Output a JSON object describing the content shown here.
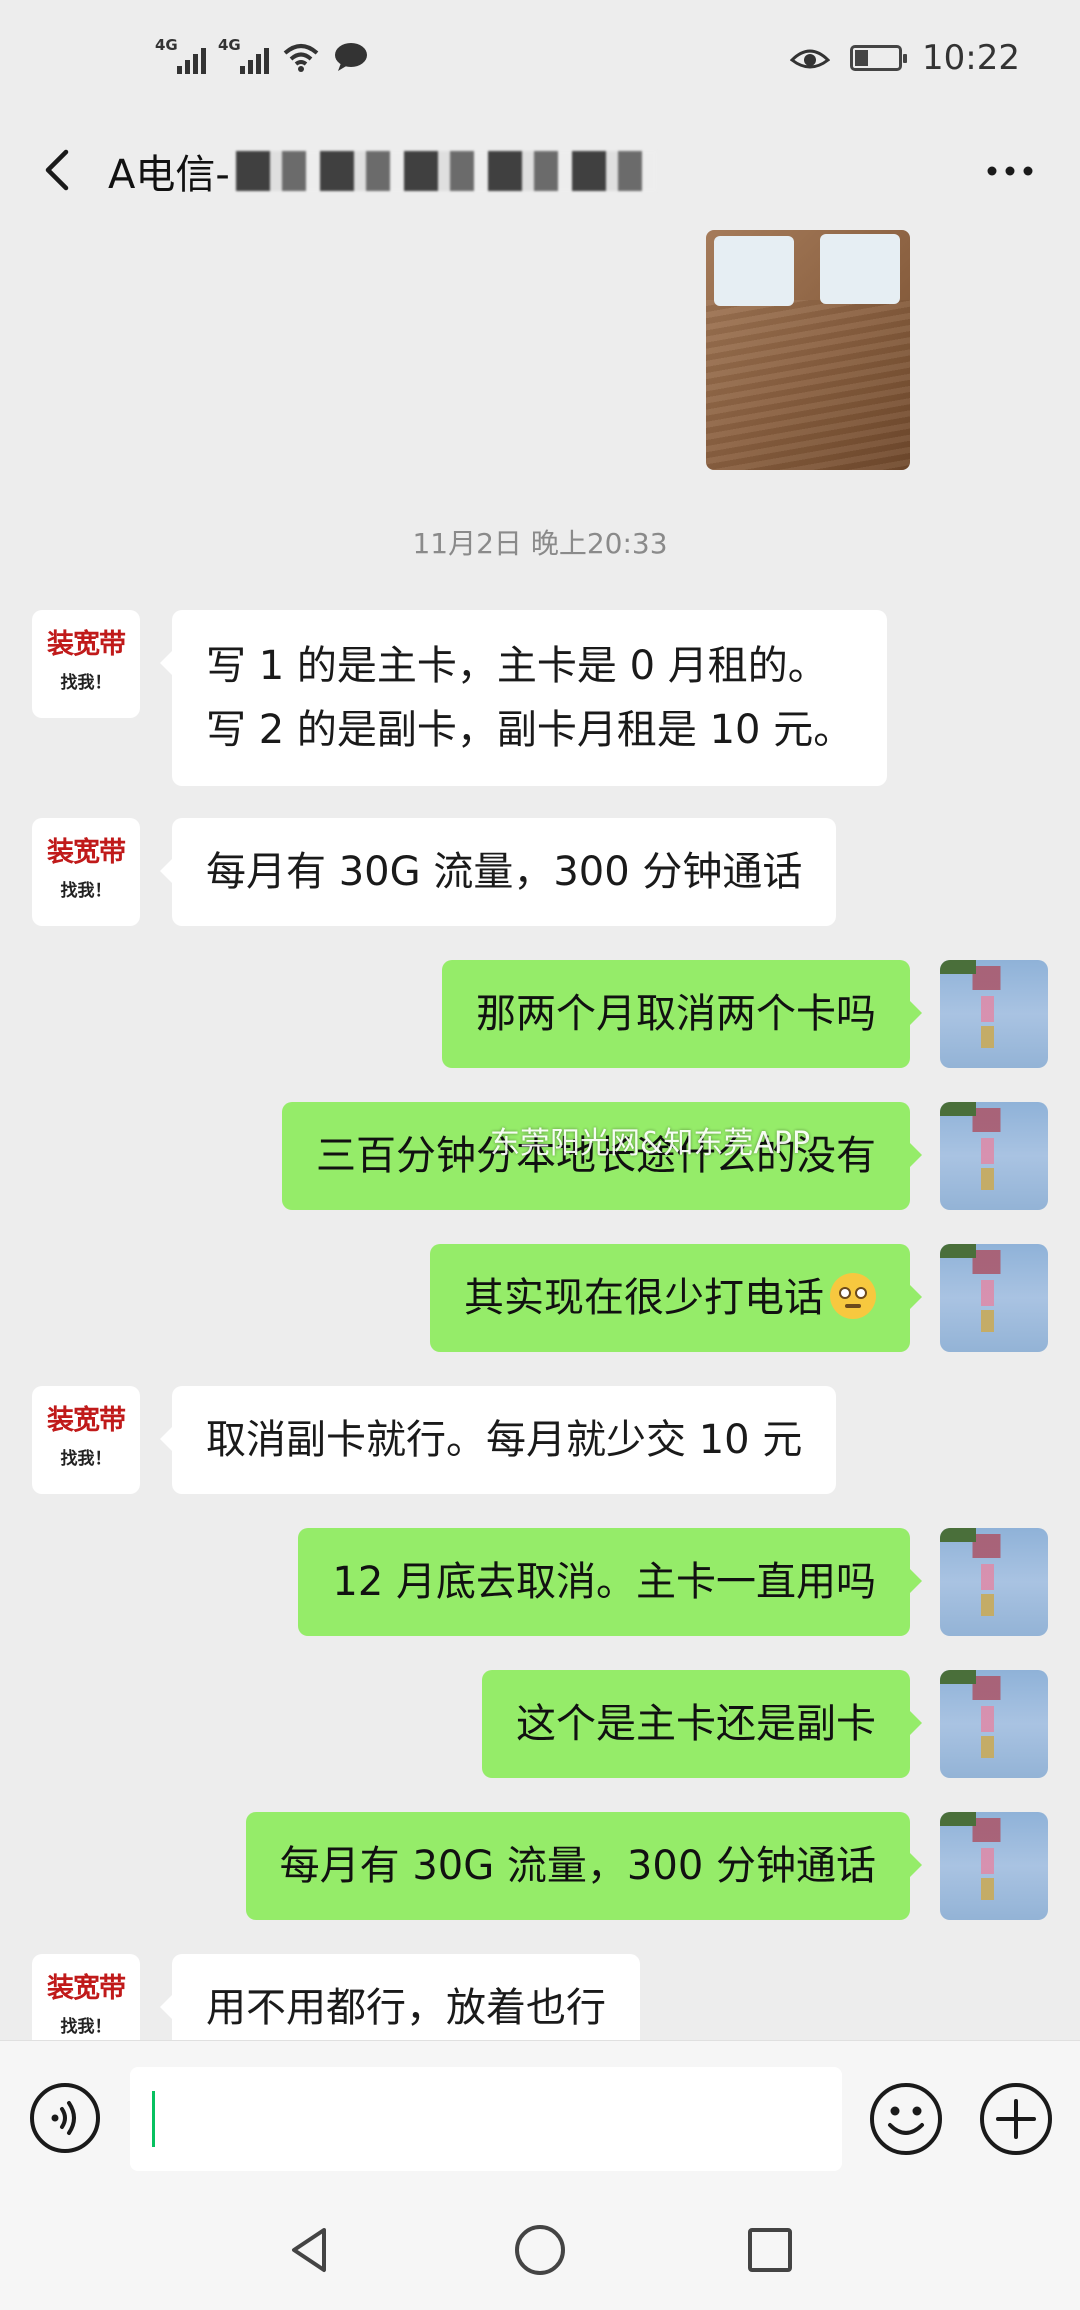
{
  "status_bar": {
    "network_1": "4G",
    "network_2": "4G",
    "time": "10:22",
    "battery_level": 0.3
  },
  "header": {
    "title_prefix": "A电信-"
  },
  "conversation": {
    "timestamp": "11月2日 晚上20:33",
    "avatar_text_line1": "装宽带",
    "avatar_text_line2": "找我！",
    "messages": [
      {
        "side": "left",
        "lines": [
          "写 1 的是主卡，主卡是 0 月租的。",
          "写 2 的是副卡，副卡月租是 10 元。"
        ]
      },
      {
        "side": "left",
        "text": "每月有 30G 流量，300 分钟通话"
      },
      {
        "side": "right",
        "text": "那两个月取消两个卡吗"
      },
      {
        "side": "right",
        "text": "三百分钟分本地长途什么的没有"
      },
      {
        "side": "right",
        "text": "其实现在很少打电话"
      },
      {
        "side": "left",
        "text": "取消副卡就行。每月就少交 10 元"
      },
      {
        "side": "right",
        "text": "12 月底去取消。主卡一直用吗"
      },
      {
        "side": "right",
        "text": "这个是主卡还是副卡"
      },
      {
        "side": "right",
        "text": "每月有 30G 流量，300 分钟通话"
      },
      {
        "side": "left",
        "text": "用不用都行，放着也行"
      }
    ]
  },
  "watermark": {
    "text": "东莞阳光网&知东莞APP"
  },
  "input_bar": {
    "icons": [
      "voice-icon",
      "emoji-icon",
      "plus-icon"
    ]
  },
  "nav_bar": {
    "icons": [
      "back-triangle-icon",
      "home-circle-icon",
      "recents-square-icon"
    ]
  }
}
